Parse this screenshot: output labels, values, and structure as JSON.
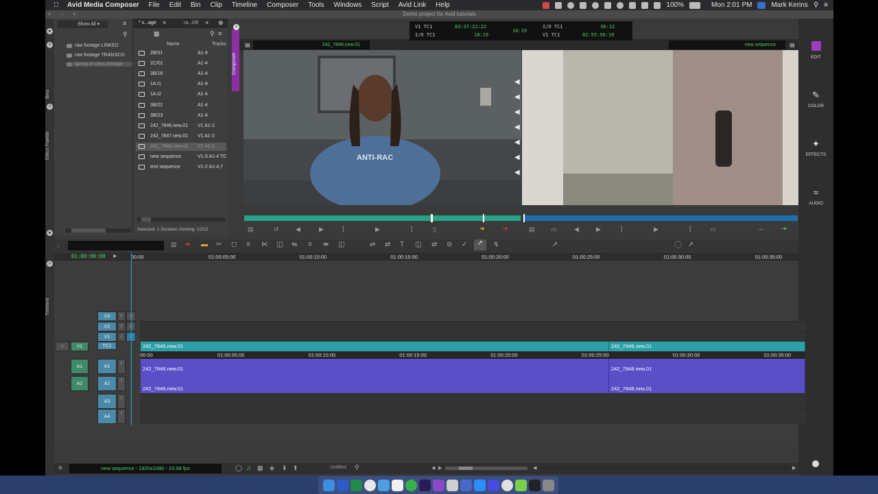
{
  "menubar": {
    "app_name": "Avid Media Composer",
    "items": [
      "File",
      "Edit",
      "Bin",
      "Clip",
      "Timeline",
      "Composer",
      "Tools",
      "Windows",
      "Script",
      "Avid Link",
      "Help"
    ],
    "battery": "100%",
    "datetime": "Mon 2:01 PM",
    "user": "Mark Kerins"
  },
  "window": {
    "title": "Demo project for Avid tutorials"
  },
  "left_strip": {
    "bins_label": "Bins",
    "effect_palette_label": "Effect Palette",
    "timeline_label": "Timeline"
  },
  "bins": {
    "filter": "Show All",
    "items": [
      "raw footage LINKED",
      "raw footage TRANSCO",
      "spring in-class footage"
    ]
  },
  "bin_tabs": [
    "* s...age",
    "ra...DE"
  ],
  "bin_columns": {
    "name": "Name",
    "tracks": "Tracks"
  },
  "bin_rows": [
    {
      "name": "2B/01",
      "tracks": "A1-4"
    },
    {
      "name": "2C/01",
      "tracks": "A1-4"
    },
    {
      "name": "3B/18",
      "tracks": "A1-4"
    },
    {
      "name": "1A t1",
      "tracks": "A1-4"
    },
    {
      "name": "1A t2",
      "tracks": "A1-4"
    },
    {
      "name": "3B/22",
      "tracks": "A1-4"
    },
    {
      "name": "3B/23",
      "tracks": "A1-4"
    },
    {
      "name": "242_7846.new.01",
      "tracks": "V1 A1-2"
    },
    {
      "name": "242_7847.new.01",
      "tracks": "V1 A1-2"
    },
    {
      "name": "242_7848.new.01",
      "tracks": "V1 A1-2"
    },
    {
      "name": "new sequence",
      "tracks": "V1-3 A1-4 TC"
    },
    {
      "name": "test sequence",
      "tracks": "V1-2 A1-4,7"
    }
  ],
  "bin_status": "Selected: 1  Duration  Viewing: 12/12",
  "composer": {
    "tab_label": "Composer",
    "source_clip": "242_7848.new.01",
    "record_clip": "new sequence",
    "tc_left_top_label": "V1  TC1",
    "tc_left_top_value": "03:37:21:22",
    "tc_left_bottom_label": "I/O  TC1",
    "tc_left_bottom_value": "10:19",
    "tc_center": "10:19",
    "tc_right_top_label": "I/O  TC1",
    "tc_right_top_value": "36:12",
    "tc_right_bottom_label": "V1  TC1",
    "tc_right_bottom_value": "02:55:56:19"
  },
  "right_panel": {
    "edit": "EDIT",
    "color": "COLOR",
    "effects": "EFFECTS",
    "audio": "AUDIO"
  },
  "timeline": {
    "position": "01:00:00:00",
    "ruler": [
      "00:00",
      "01:00:05:00",
      "01:00:10:00",
      "01:00:15:00",
      "01:00:20:00",
      "01:00:25:00",
      "01:00:30:00",
      "01:00:35:00"
    ],
    "tracks": [
      "V3",
      "V2",
      "V1",
      "TC1",
      "A1",
      "A2",
      "A3",
      "A4"
    ],
    "source_tracks": {
      "v1": "V1",
      "a1": "A1",
      "a2": "A2"
    },
    "clip_a": "242_7846.new.01",
    "clip_b": "242_7848.new.01",
    "status": "new sequence - 1920x1080 - 23.98 fps",
    "untitled": "Untitled"
  }
}
